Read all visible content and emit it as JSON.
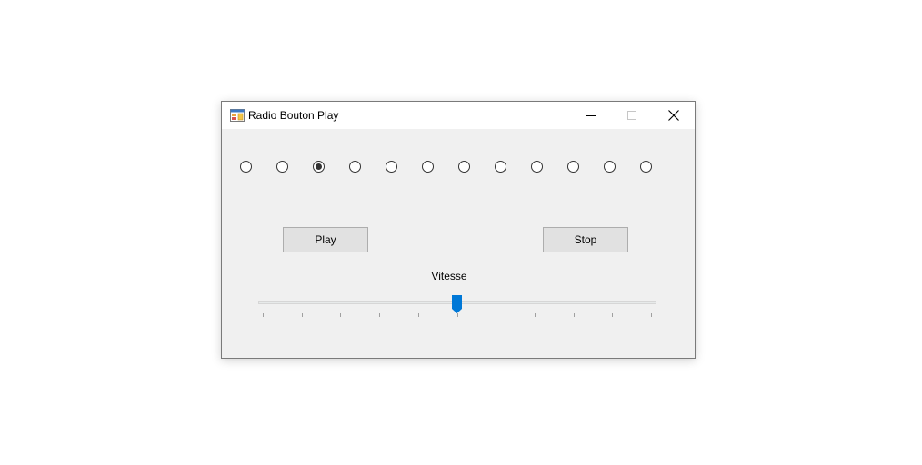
{
  "window": {
    "title": "Radio Bouton Play",
    "app_icon": "form-app-icon",
    "controls": [
      "minimize-icon",
      "maximize-icon",
      "close-icon"
    ]
  },
  "radios": {
    "count": 12,
    "checked_index": 2
  },
  "buttons": {
    "play_label": "Play",
    "stop_label": "Stop"
  },
  "slider": {
    "label": "Vitesse",
    "min": 0,
    "max": 10,
    "value": 5,
    "tick_count": 11,
    "accent_color": "#0078d7"
  },
  "colors": {
    "window_bg": "#f0f0f0",
    "titlebar_bg": "#ffffff",
    "button_bg": "#e1e1e1"
  }
}
